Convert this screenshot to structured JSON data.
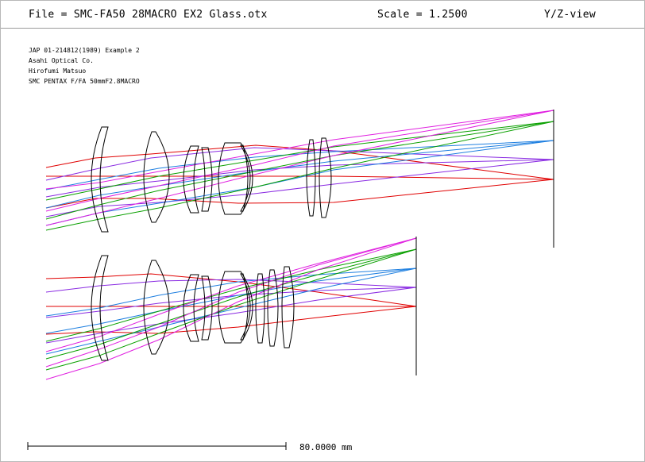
{
  "header": {
    "file": "File = SMC-FA50 28MACRO EX2 Glass.otx",
    "scale": "Scale = 1.2500",
    "view": "Y/Z-view"
  },
  "info_lines": [
    "JAP 01-214812(1989) Example 2",
    "Asahi Optical Co.",
    "Hirofumi Matsuo",
    "SMC PENTAX F/FA 50mmF2.8MACRO"
  ],
  "scale_bar": {
    "label": "80.0000 mm"
  },
  "colors": {
    "lens": "#000000",
    "red": "#e00000",
    "purple": "#8a2be2",
    "blue": "#1e7fe0",
    "green": "#0aa000",
    "magenta": "#e020e0"
  }
}
